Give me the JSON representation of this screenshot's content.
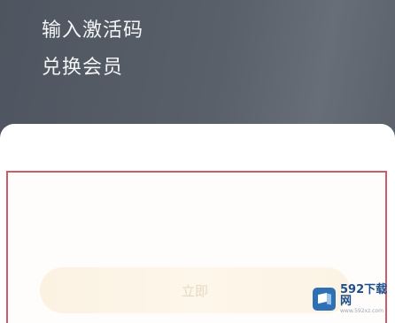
{
  "header": {
    "title": "输入激活码",
    "subtitle": "兑换会员"
  },
  "form": {
    "code_value": "",
    "code_placeholder": "",
    "redeem_label": "立即"
  },
  "watermark": {
    "text": "592下载网",
    "sub": "www.592xz.com"
  },
  "colors": {
    "header_bg": "#596069",
    "input_border": "#c95d6c",
    "button_bg": "#fbf2e2",
    "button_text": "#e7d9c2",
    "watermark_blue": "#2f6fb4"
  }
}
